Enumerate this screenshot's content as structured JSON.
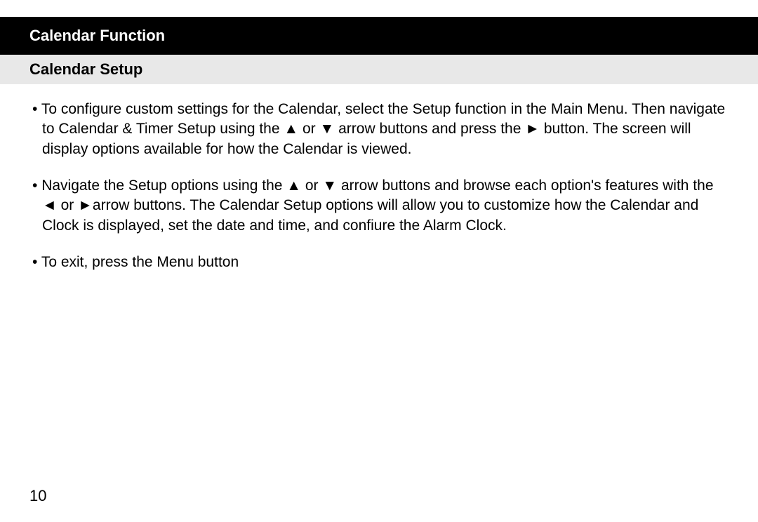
{
  "header": {
    "title": "Calendar Function",
    "subtitle": "Calendar Setup"
  },
  "bullets": [
    "To configure custom settings for the Calendar, select the Setup function in the Main Menu.  Then navigate to Calendar & Timer Setup using the ▲ or ▼ arrow buttons and press the ► button.  The screen will display options available for how the Calendar is viewed.",
    "Navigate the Setup options using the ▲ or ▼ arrow buttons and browse each option's features with the ◄ or ►arrow buttons.  The Calendar Setup options will allow you to customize how the Calendar and Clock is displayed, set the date and time, and confiure the Alarm Clock.",
    "To exit, press the Menu button"
  ],
  "page_number": "10"
}
